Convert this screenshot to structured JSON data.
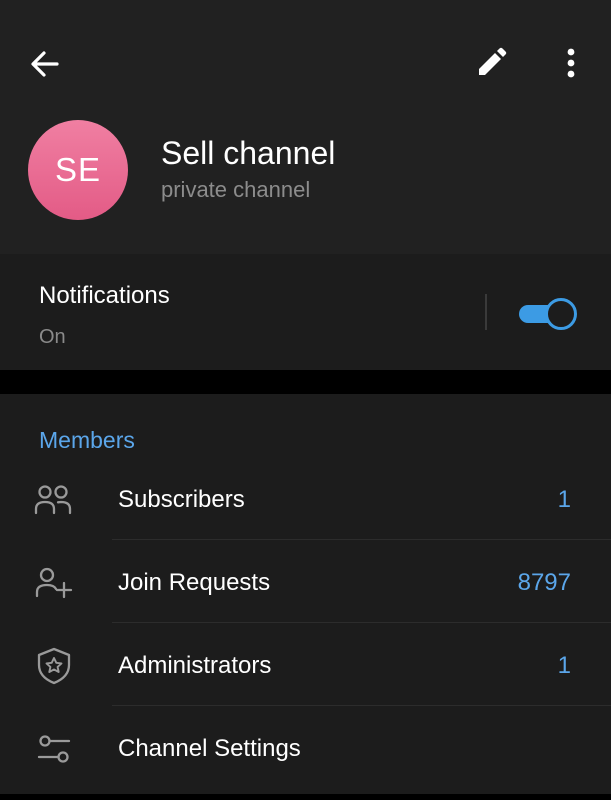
{
  "header": {
    "avatar_initials": "SE",
    "title": "Sell channel",
    "subtitle": "private channel",
    "icons": [
      "back-arrow-icon",
      "pencil-icon",
      "more-vertical-icon"
    ]
  },
  "notifications": {
    "label": "Notifications",
    "status": "On",
    "toggle_on": true
  },
  "members": {
    "section_title": "Members",
    "rows": [
      {
        "label": "Subscribers",
        "value": "1",
        "icon": "people-icon"
      },
      {
        "label": "Join Requests",
        "value": "8797",
        "icon": "person-add-icon"
      },
      {
        "label": "Administrators",
        "value": "1",
        "icon": "shield-star-icon"
      },
      {
        "label": "Channel Settings",
        "value": "",
        "icon": "sliders-icon"
      }
    ]
  },
  "colors": {
    "accent": "#5ba6ea",
    "toggle": "#3c9be4",
    "avatar": "#ea6b93",
    "background": "#1c1c1c",
    "header_background": "#212121"
  }
}
